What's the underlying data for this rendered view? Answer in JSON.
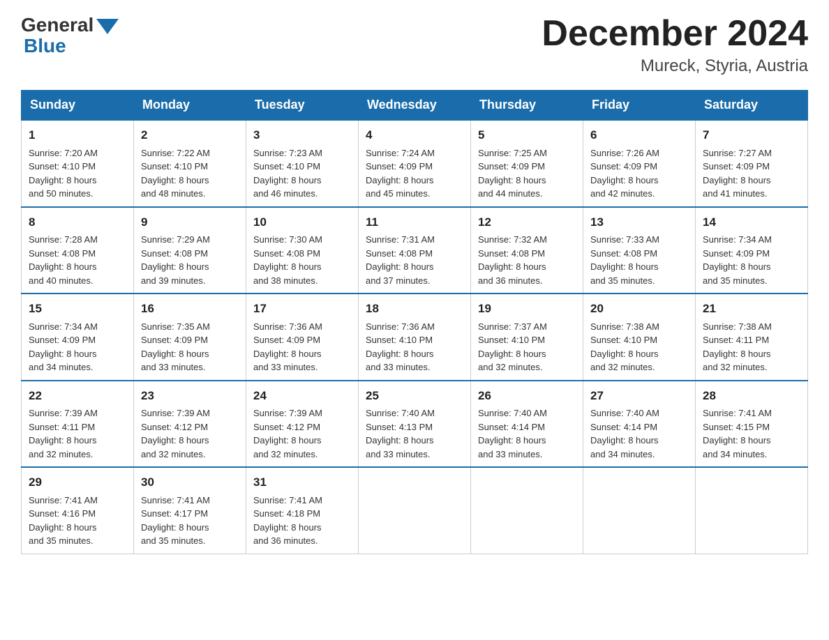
{
  "header": {
    "logo_general": "General",
    "logo_blue": "Blue",
    "month_title": "December 2024",
    "location": "Mureck, Styria, Austria"
  },
  "days_of_week": [
    "Sunday",
    "Monday",
    "Tuesday",
    "Wednesday",
    "Thursday",
    "Friday",
    "Saturday"
  ],
  "weeks": [
    [
      {
        "day": "1",
        "sunrise": "7:20 AM",
        "sunset": "4:10 PM",
        "daylight": "8 hours and 50 minutes."
      },
      {
        "day": "2",
        "sunrise": "7:22 AM",
        "sunset": "4:10 PM",
        "daylight": "8 hours and 48 minutes."
      },
      {
        "day": "3",
        "sunrise": "7:23 AM",
        "sunset": "4:10 PM",
        "daylight": "8 hours and 46 minutes."
      },
      {
        "day": "4",
        "sunrise": "7:24 AM",
        "sunset": "4:09 PM",
        "daylight": "8 hours and 45 minutes."
      },
      {
        "day": "5",
        "sunrise": "7:25 AM",
        "sunset": "4:09 PM",
        "daylight": "8 hours and 44 minutes."
      },
      {
        "day": "6",
        "sunrise": "7:26 AM",
        "sunset": "4:09 PM",
        "daylight": "8 hours and 42 minutes."
      },
      {
        "day": "7",
        "sunrise": "7:27 AM",
        "sunset": "4:09 PM",
        "daylight": "8 hours and 41 minutes."
      }
    ],
    [
      {
        "day": "8",
        "sunrise": "7:28 AM",
        "sunset": "4:08 PM",
        "daylight": "8 hours and 40 minutes."
      },
      {
        "day": "9",
        "sunrise": "7:29 AM",
        "sunset": "4:08 PM",
        "daylight": "8 hours and 39 minutes."
      },
      {
        "day": "10",
        "sunrise": "7:30 AM",
        "sunset": "4:08 PM",
        "daylight": "8 hours and 38 minutes."
      },
      {
        "day": "11",
        "sunrise": "7:31 AM",
        "sunset": "4:08 PM",
        "daylight": "8 hours and 37 minutes."
      },
      {
        "day": "12",
        "sunrise": "7:32 AM",
        "sunset": "4:08 PM",
        "daylight": "8 hours and 36 minutes."
      },
      {
        "day": "13",
        "sunrise": "7:33 AM",
        "sunset": "4:08 PM",
        "daylight": "8 hours and 35 minutes."
      },
      {
        "day": "14",
        "sunrise": "7:34 AM",
        "sunset": "4:09 PM",
        "daylight": "8 hours and 35 minutes."
      }
    ],
    [
      {
        "day": "15",
        "sunrise": "7:34 AM",
        "sunset": "4:09 PM",
        "daylight": "8 hours and 34 minutes."
      },
      {
        "day": "16",
        "sunrise": "7:35 AM",
        "sunset": "4:09 PM",
        "daylight": "8 hours and 33 minutes."
      },
      {
        "day": "17",
        "sunrise": "7:36 AM",
        "sunset": "4:09 PM",
        "daylight": "8 hours and 33 minutes."
      },
      {
        "day": "18",
        "sunrise": "7:36 AM",
        "sunset": "4:10 PM",
        "daylight": "8 hours and 33 minutes."
      },
      {
        "day": "19",
        "sunrise": "7:37 AM",
        "sunset": "4:10 PM",
        "daylight": "8 hours and 32 minutes."
      },
      {
        "day": "20",
        "sunrise": "7:38 AM",
        "sunset": "4:10 PM",
        "daylight": "8 hours and 32 minutes."
      },
      {
        "day": "21",
        "sunrise": "7:38 AM",
        "sunset": "4:11 PM",
        "daylight": "8 hours and 32 minutes."
      }
    ],
    [
      {
        "day": "22",
        "sunrise": "7:39 AM",
        "sunset": "4:11 PM",
        "daylight": "8 hours and 32 minutes."
      },
      {
        "day": "23",
        "sunrise": "7:39 AM",
        "sunset": "4:12 PM",
        "daylight": "8 hours and 32 minutes."
      },
      {
        "day": "24",
        "sunrise": "7:39 AM",
        "sunset": "4:12 PM",
        "daylight": "8 hours and 32 minutes."
      },
      {
        "day": "25",
        "sunrise": "7:40 AM",
        "sunset": "4:13 PM",
        "daylight": "8 hours and 33 minutes."
      },
      {
        "day": "26",
        "sunrise": "7:40 AM",
        "sunset": "4:14 PM",
        "daylight": "8 hours and 33 minutes."
      },
      {
        "day": "27",
        "sunrise": "7:40 AM",
        "sunset": "4:14 PM",
        "daylight": "8 hours and 34 minutes."
      },
      {
        "day": "28",
        "sunrise": "7:41 AM",
        "sunset": "4:15 PM",
        "daylight": "8 hours and 34 minutes."
      }
    ],
    [
      {
        "day": "29",
        "sunrise": "7:41 AM",
        "sunset": "4:16 PM",
        "daylight": "8 hours and 35 minutes."
      },
      {
        "day": "30",
        "sunrise": "7:41 AM",
        "sunset": "4:17 PM",
        "daylight": "8 hours and 35 minutes."
      },
      {
        "day": "31",
        "sunrise": "7:41 AM",
        "sunset": "4:18 PM",
        "daylight": "8 hours and 36 minutes."
      },
      null,
      null,
      null,
      null
    ]
  ],
  "labels": {
    "sunrise": "Sunrise:",
    "sunset": "Sunset:",
    "daylight": "Daylight:"
  }
}
